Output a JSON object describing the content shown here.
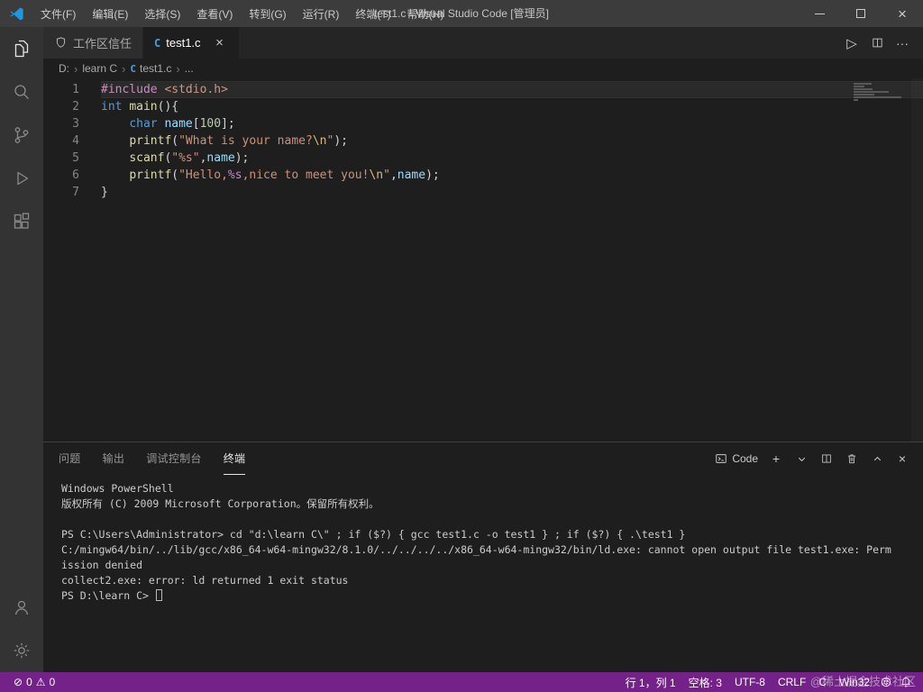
{
  "colors": {
    "statusbar": "#75218a",
    "titlebar": "#3c3c3c",
    "activitybar": "#333333",
    "editor_background": "#1e1e1e",
    "c_icon_blue": "#3ba3e8"
  },
  "titlebar": {
    "menus": [
      "文件(F)",
      "编辑(E)",
      "选择(S)",
      "查看(V)",
      "转到(G)",
      "运行(R)",
      "终端(T)",
      "帮助(H)"
    ],
    "title": "test1.c - Visual Studio Code [管理员]"
  },
  "activitybar": {
    "top": [
      "explorer",
      "search",
      "source-control",
      "run-and-debug",
      "extensions"
    ],
    "bottom": [
      "accounts",
      "settings"
    ]
  },
  "tabbar": {
    "trust_tab_label": "工作区信任",
    "file_tab_label": "test1.c",
    "file_icon": "C",
    "close_glyph": "×",
    "run_glyph": "▷",
    "more_glyph": "···"
  },
  "breadcrumb": [
    {
      "label": "D:"
    },
    {
      "label": "learn C"
    },
    {
      "label": "test1.c",
      "icon": "C"
    },
    {
      "label": "..."
    }
  ],
  "editor": {
    "language": "c",
    "current_line": 1,
    "lines": [
      [
        [
          "kw",
          "#include"
        ],
        [
          "pl",
          " "
        ],
        [
          "str",
          "<stdio.h>"
        ]
      ],
      [
        [
          "type",
          "int"
        ],
        [
          "pl",
          " "
        ],
        [
          "fn",
          "main"
        ],
        [
          "pl",
          "(){"
        ]
      ],
      [
        [
          "pl",
          "    "
        ],
        [
          "type",
          "char"
        ],
        [
          "pl",
          " "
        ],
        [
          "var",
          "name"
        ],
        [
          "pl",
          "["
        ],
        [
          "num",
          "100"
        ],
        [
          "pl",
          "];"
        ]
      ],
      [
        [
          "pl",
          "    "
        ],
        [
          "fn",
          "printf"
        ],
        [
          "pl",
          "("
        ],
        [
          "str",
          "\"What is your name?"
        ],
        [
          "esc",
          "\\n"
        ],
        [
          "str",
          "\""
        ],
        [
          "pl",
          ");"
        ]
      ],
      [
        [
          "pl",
          "    "
        ],
        [
          "fn",
          "scanf"
        ],
        [
          "pl",
          "("
        ],
        [
          "str",
          "\"%s\""
        ],
        [
          "pl",
          ","
        ],
        [
          "var",
          "name"
        ],
        [
          "pl",
          ");"
        ]
      ],
      [
        [
          "pl",
          "    "
        ],
        [
          "fn",
          "printf"
        ],
        [
          "pl",
          "("
        ],
        [
          "str",
          "\"Hello,"
        ],
        [
          "fmt",
          "%s"
        ],
        [
          "str",
          ",nice to meet you!"
        ],
        [
          "esc",
          "\\n"
        ],
        [
          "str",
          "\""
        ],
        [
          "pl",
          ","
        ],
        [
          "var",
          "name"
        ],
        [
          "pl",
          ");"
        ]
      ],
      [
        [
          "pl",
          "}"
        ]
      ]
    ]
  },
  "panel": {
    "tabs": [
      "问题",
      "输出",
      "调试控制台",
      "终端"
    ],
    "active_tab": "终端",
    "profile_label": "Code",
    "plus_glyph": "+",
    "close_glyph": "×",
    "terminal_lines": [
      "Windows PowerShell",
      "版权所有 (C) 2009 Microsoft Corporation。保留所有权利。",
      "",
      "PS C:\\Users\\Administrator> cd \"d:\\learn C\\\" ; if ($?) { gcc test1.c -o test1 } ; if ($?) { .\\test1 }",
      "C:/mingw64/bin/../lib/gcc/x86_64-w64-mingw32/8.1.0/../../../../x86_64-w64-mingw32/bin/ld.exe: cannot open output file test1.exe: Perm",
      "ission denied",
      "collect2.exe: error: ld returned 1 exit status",
      "PS D:\\learn C> "
    ]
  },
  "statusbar": {
    "error_icon": "⊘",
    "errors": "0",
    "warning_icon": "⚠",
    "warnings": "0",
    "right_items": [
      "行 1，列 1",
      "空格: 3",
      "UTF-8",
      "CRLF",
      "C",
      "Win32"
    ]
  },
  "watermark": "@稀土掘金技术社区"
}
